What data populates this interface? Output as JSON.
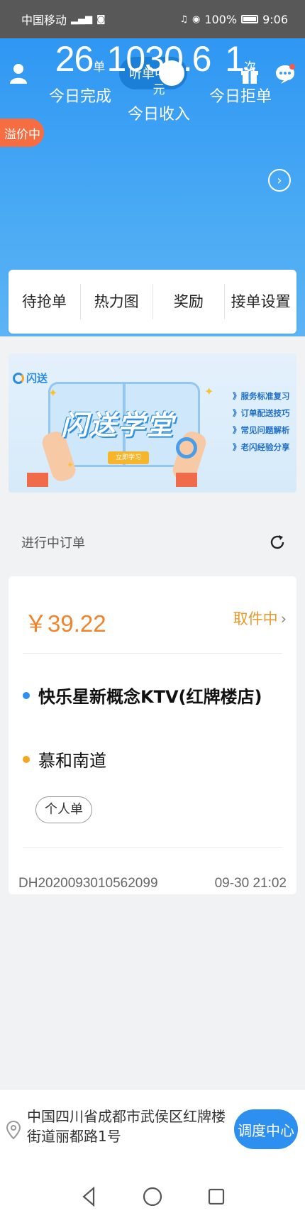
{
  "status_bar": {
    "carrier": "中国移动",
    "battery": "100%",
    "time": "9:06"
  },
  "header": {
    "listening_toggle": "听单中",
    "premium_badge": "溢价中",
    "stats": {
      "completed": {
        "value": "26",
        "unit": "单",
        "label": "今日完成"
      },
      "income": {
        "value": "1030.6",
        "unit": "元",
        "label": "今日收入"
      },
      "rejected": {
        "value": "1",
        "unit": "次",
        "label": "今日拒单"
      }
    }
  },
  "tabs": [
    {
      "label": "待抢单"
    },
    {
      "label": "热力图"
    },
    {
      "label": "奖励"
    },
    {
      "label": "接单设置"
    }
  ],
  "banner": {
    "logo_text": "闪送",
    "title": "闪送学堂",
    "button_text": "立即学习",
    "items": [
      "》服务标准复习",
      "》订单配送技巧",
      "》常见问题解析",
      "》老闪经验分享"
    ]
  },
  "ongoing": {
    "title": "进行中订单"
  },
  "order": {
    "price": "￥39.22",
    "status": "取件中",
    "pickup_address": "快乐星新概念KTV(红牌楼店)",
    "dropoff_address": "慕和南道",
    "tag": "个人单",
    "order_id": "DH2020093010562099",
    "time": "09-30 21:02",
    "colors": {
      "price": "#f0842c",
      "pickup_dot": "#2d8ff0",
      "dropoff_dot": "#f5a623"
    }
  },
  "location": {
    "address": "中国四川省成都市武侯区红牌楼街道丽都路1号",
    "dispatch_button": "调度中心"
  },
  "colors": {
    "primary": "#2f97f3",
    "premium": "#f76d42"
  }
}
